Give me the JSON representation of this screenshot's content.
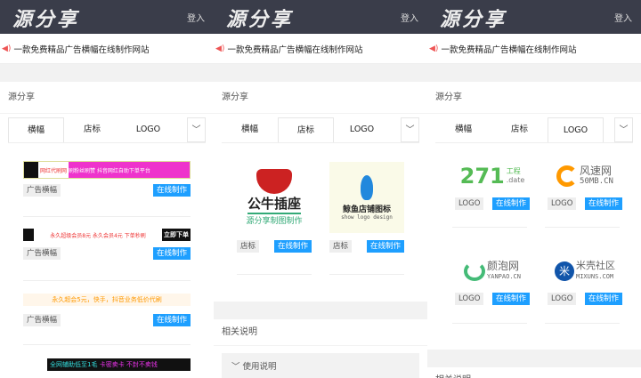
{
  "header": {
    "logo": "源分享",
    "login": "登入"
  },
  "notice": "一款免费精品广告横幅在线制作网站",
  "section_title": "源分享",
  "tabs": [
    "横幅",
    "店标",
    "LOGO"
  ],
  "tag_banner": "广告横幅",
  "tag_shop": "店标",
  "tag_logo": "LOGO",
  "make_btn": "在线制作",
  "banners": [
    {
      "t1": "网红代刷网",
      "t2": "刷粉丝刷赞",
      "t3": "抖音网红自助下单平台"
    },
    {
      "t1": "永久超级会员8元 永久会员4元 下单秒刷",
      "t2": "立即下单"
    },
    {
      "t1": "永久超会5元，快手，抖音业务低价代刷"
    },
    {
      "t1": "全网辅助低至1毛",
      "t2": "卡密卖卡 不封不卖钱"
    }
  ],
  "shop_logos": [
    {
      "name": "公牛插座",
      "sub": "源分享制图制作"
    },
    {
      "name": "鲸鱼店铺图标",
      "sub": "show logo design"
    }
  ],
  "logos": [
    {
      "a": "271",
      "b": "工程",
      ".c": "",
      "c": ".date"
    },
    {
      "a": "风速网",
      "c": "50MB.CN"
    },
    {
      "a": "颜泡网",
      "c": "YANPAO.CN"
    },
    {
      "a": "米壳社区",
      "c": "MIXUNS.COM"
    }
  ],
  "related": "相关说明",
  "usage": "使用说明"
}
